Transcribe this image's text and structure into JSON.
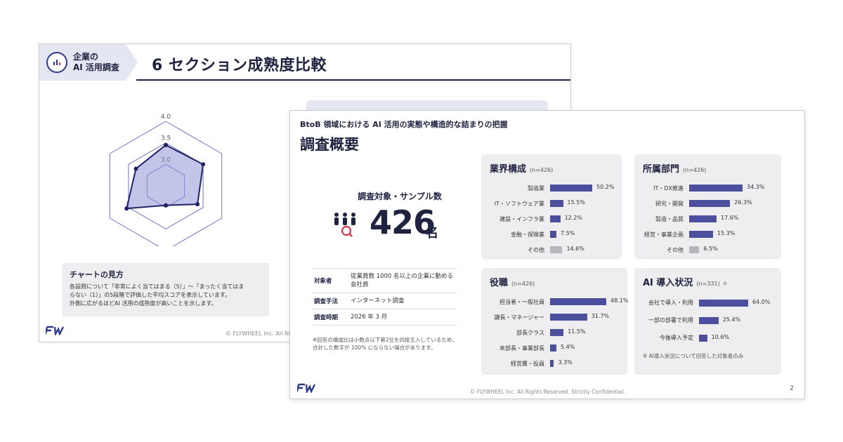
{
  "back_slide": {
    "badge": {
      "line1": "企業の",
      "line2": "AI 活用調査",
      "icon": "magnifier-chart-icon"
    },
    "title": "6 セクション成熟度比較",
    "radar": {
      "tick_labels": [
        "4.0",
        "3.5",
        "3.0"
      ],
      "values": [
        3.45,
        3.5,
        3.35,
        2.95,
        3.55,
        3.3
      ]
    },
    "guide": {
      "title": "チャートの見方",
      "line1": "各設問について「非常によく当てはまる（5）」〜「まったく当てはま",
      "line2": "らない（1）」の5段階で評価した平均スコアを表示しています。",
      "line3": "外側に広がるほどAI 活用の成熟度が高いことを示します。"
    },
    "copyright": "© FLYWHEEL Inc. All Rights"
  },
  "front_slide": {
    "subtitle": "BtoB 領域における AI 活用の実態や構造的な詰まりの把握",
    "title": "調査概要",
    "sample": {
      "label": "調査対象・サンプル数",
      "number": "426",
      "unit": "名",
      "icon": "people-search-icon"
    },
    "info": [
      {
        "key": "対象者",
        "value": "従業員数 1000 名以上の企業に勤める会社員"
      },
      {
        "key": "調査手法",
        "value": "インターネット調査"
      },
      {
        "key": "調査時期",
        "value": "2026 年 3 月"
      }
    ],
    "note": "※回答の構成比は小数点以下第2位を四捨五入しているため、合計した数字が 100% にならない場合があります。",
    "copyright": "© FLYWHEEL Inc. All Rights Reserved. Strictly Confidential.",
    "page_number": "2"
  },
  "cards": {
    "industry": {
      "title": "業界構成",
      "n": "(n=426)",
      "items": [
        {
          "label": "製造業",
          "value": 50.2,
          "text": "50.2%",
          "other": false
        },
        {
          "label": "IT・ソフトウェア業",
          "value": 15.5,
          "text": "15.5%",
          "other": false
        },
        {
          "label": "建設・インフラ業",
          "value": 12.2,
          "text": "12.2%",
          "other": false
        },
        {
          "label": "金融・保険業",
          "value": 7.5,
          "text": "7.5%",
          "other": false
        },
        {
          "label": "その他",
          "value": 14.6,
          "text": "14.6%",
          "other": true
        }
      ]
    },
    "department": {
      "title": "所属部門",
      "n": "(n=426)",
      "items": [
        {
          "label": "IT・DX推進",
          "value": 34.3,
          "text": "34.3%",
          "other": false
        },
        {
          "label": "研究・開発",
          "value": 26.3,
          "text": "26.3%",
          "other": false
        },
        {
          "label": "製造・品質",
          "value": 17.6,
          "text": "17.6%",
          "other": false
        },
        {
          "label": "経営・事業企画",
          "value": 15.3,
          "text": "15.3%",
          "other": false
        },
        {
          "label": "その他",
          "value": 6.5,
          "text": "6.5%",
          "other": true
        }
      ]
    },
    "position": {
      "title": "役職",
      "n": "(n=426)",
      "items": [
        {
          "label": "担当者・一般社員",
          "value": 48.1,
          "text": "48.1%",
          "other": false
        },
        {
          "label": "課長・マネージャー",
          "value": 31.7,
          "text": "31.7%",
          "other": false
        },
        {
          "label": "部長クラス",
          "value": 11.5,
          "text": "11.5%",
          "other": false
        },
        {
          "label": "本部長・事業部長",
          "value": 5.4,
          "text": "5.4%",
          "other": false
        },
        {
          "label": "経営層・役員",
          "value": 3.3,
          "text": "3.3%",
          "other": false
        }
      ]
    },
    "ai_status": {
      "title": "AI 導入状況",
      "n": "(n=331)",
      "mark": "※",
      "items": [
        {
          "label": "会社で導入・利用",
          "value": 64.0,
          "text": "64.0%",
          "other": false
        },
        {
          "label": "一部の部署で利用",
          "value": 25.4,
          "text": "25.4%",
          "other": false
        },
        {
          "label": "今後導入予定",
          "value": 10.6,
          "text": "10.6%",
          "other": false
        }
      ],
      "foot": "※ AI導入状況について回答した対象者のみ"
    }
  },
  "colors": {
    "navy": "#1f2340",
    "bar": "#4b4f9e",
    "bar_other": "#b5b7bd",
    "card_bg": "#eeeef0",
    "accent_soft": "#e4e6f2"
  }
}
